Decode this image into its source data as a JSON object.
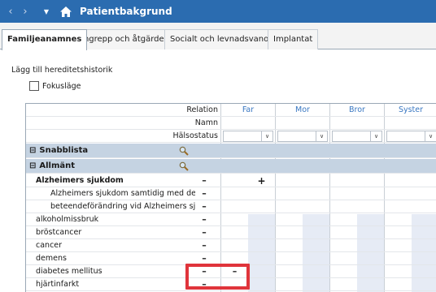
{
  "window": {
    "title": "Patientbakgrund",
    "icons": [
      "back-icon",
      "forward-icon",
      "dropdown-icon",
      "home-icon"
    ]
  },
  "tabs": [
    {
      "label": "Familjeanamnes",
      "active": true
    },
    {
      "label": "Ingrepp och åtgärder",
      "active": false
    },
    {
      "label": "Socialt och levnadsvanor",
      "active": false
    },
    {
      "label": "Implantat",
      "active": false
    }
  ],
  "content": {
    "add_label": "Lägg till hereditetshistorik",
    "focus_label": "Fokusläge",
    "focus_checked": false
  },
  "grid": {
    "header_rows": [
      "Relation",
      "Namn",
      "Hälsostatus"
    ],
    "relations": [
      "Far",
      "Mor",
      "Bror",
      "Syster"
    ],
    "sections": [
      {
        "label": "Snabblista",
        "expand_symbol": "⊟",
        "icon": "search-icon"
      },
      {
        "label": "Allmänt",
        "expand_symbol": "⊟",
        "icon": "search-icon"
      }
    ],
    "items": [
      {
        "label": "Alzheimers sjukdom",
        "bold": true,
        "indent": 0,
        "minus": "–",
        "far": "+"
      },
      {
        "label": "Alzheimers sjukdom samtidig med de...",
        "bold": false,
        "indent": 1,
        "minus": "–",
        "far": ""
      },
      {
        "label": "beteendeförändring vid Alzheimers sj...",
        "bold": false,
        "indent": 1,
        "minus": "–",
        "far": ""
      },
      {
        "label": "alkoholmissbruk",
        "bold": false,
        "indent": 0,
        "minus": "–",
        "far": ""
      },
      {
        "label": "bröstcancer",
        "bold": false,
        "indent": 0,
        "minus": "–",
        "far": ""
      },
      {
        "label": "cancer",
        "bold": false,
        "indent": 0,
        "minus": "–",
        "far": ""
      },
      {
        "label": "demens",
        "bold": false,
        "indent": 0,
        "minus": "–",
        "far": ""
      },
      {
        "label": "diabetes mellitus",
        "bold": false,
        "indent": 0,
        "minus": "–",
        "far": "–"
      },
      {
        "label": "hjärtinfarkt",
        "bold": false,
        "indent": 0,
        "minus": "–",
        "far": ""
      }
    ]
  },
  "colors": {
    "titlebar": "#2b6cb0",
    "section_bg": "#c5d3e2",
    "relation_text": "#3a78c2",
    "highlight": "#e0343b"
  }
}
